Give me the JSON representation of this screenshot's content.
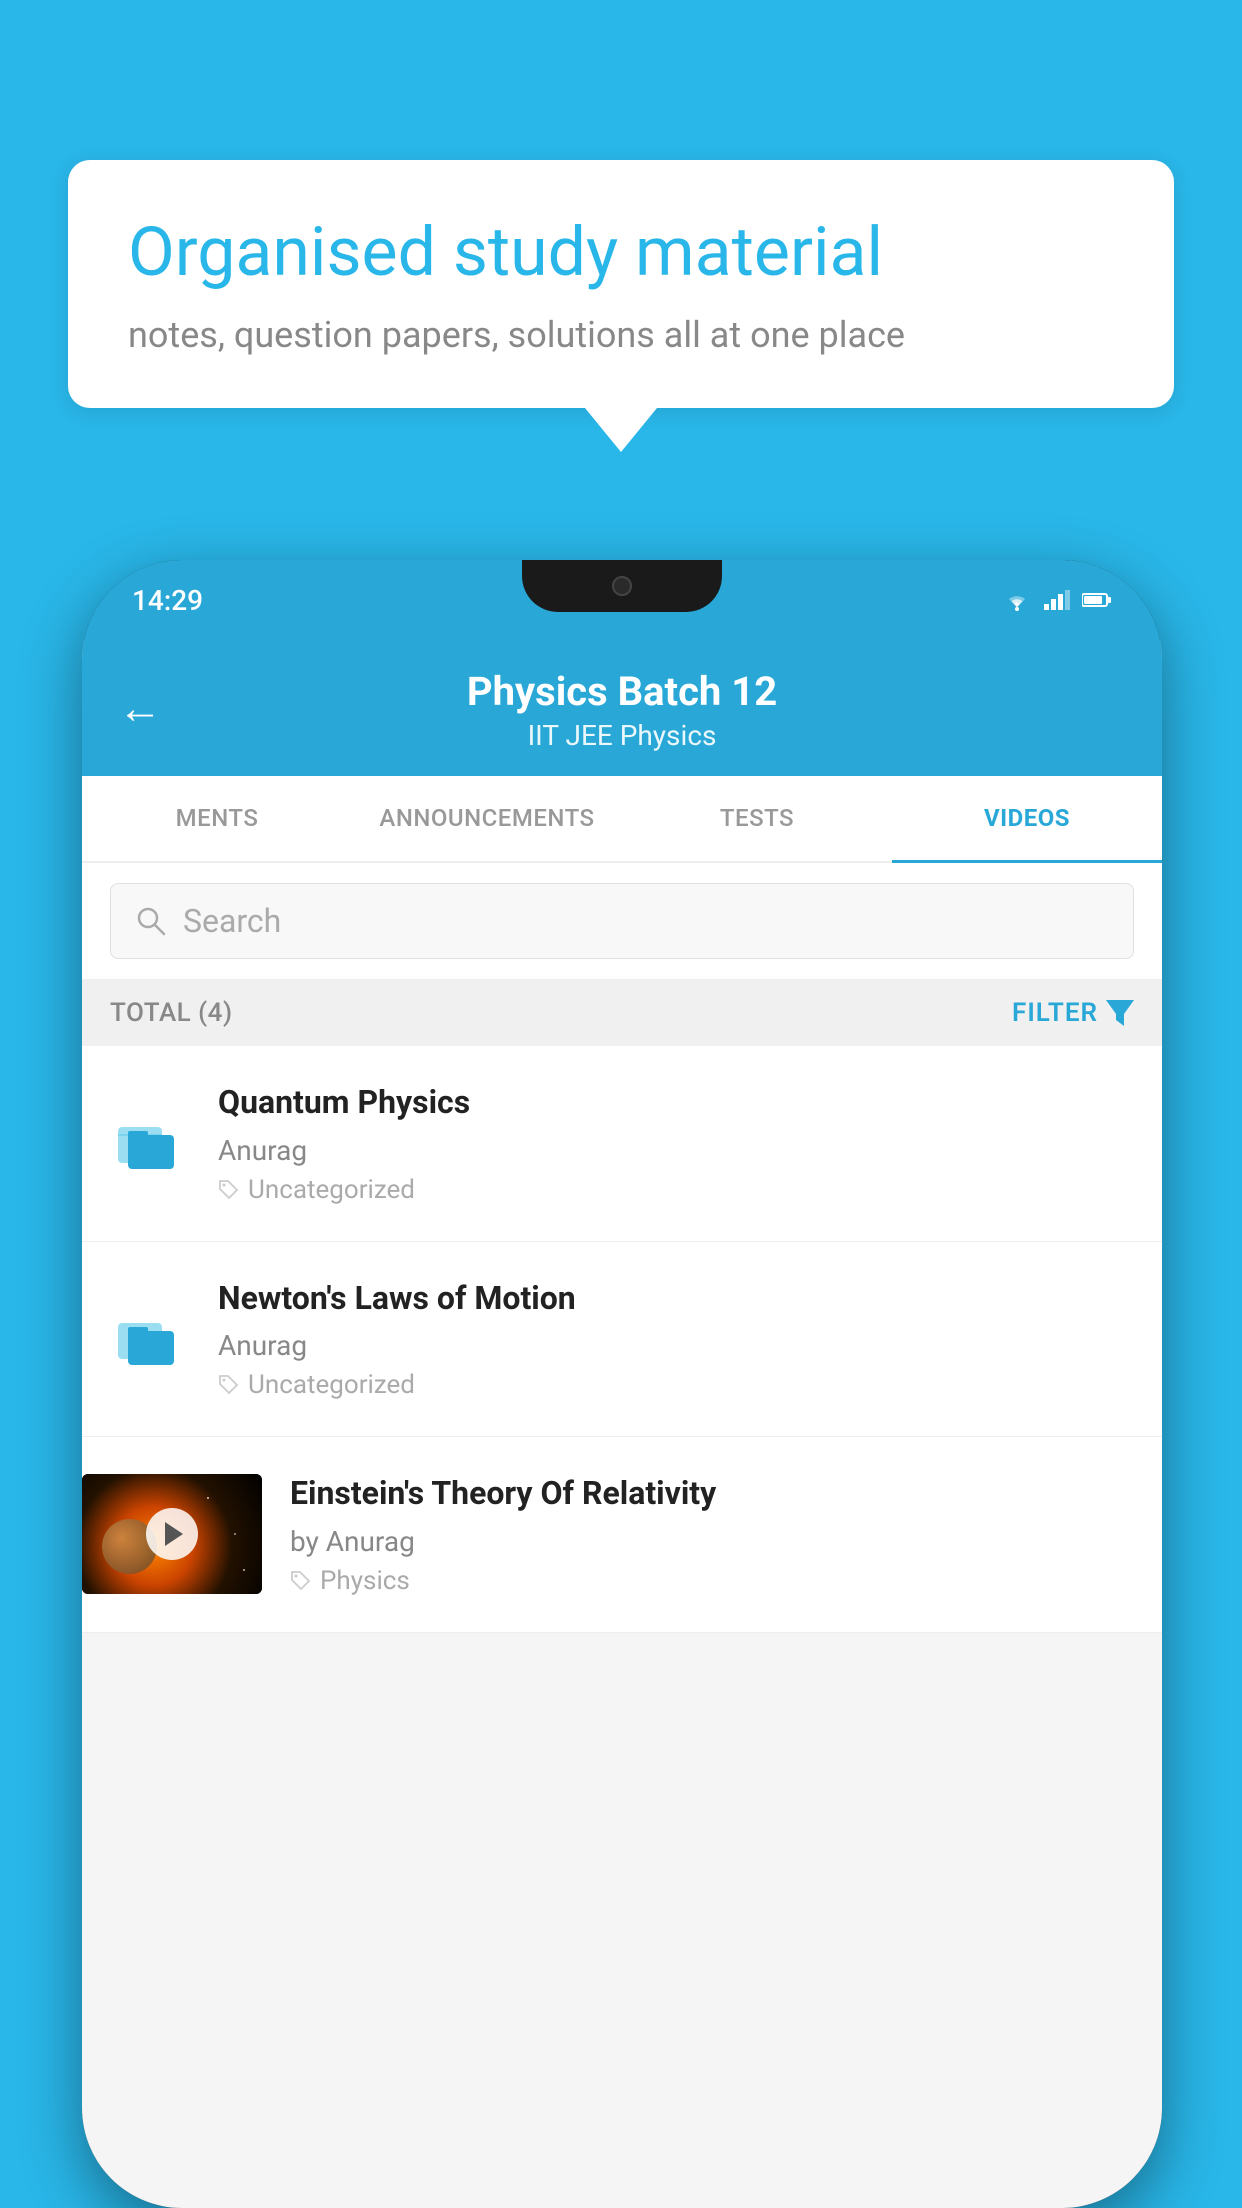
{
  "background": {
    "color": "#29b6e8"
  },
  "speech_bubble": {
    "title": "Organised study material",
    "subtitle": "notes, question papers, solutions all at one place"
  },
  "phone": {
    "status_bar": {
      "time": "14:29",
      "wifi": "▼",
      "signal": "▲",
      "battery": "▮"
    },
    "header": {
      "back_label": "←",
      "title": "Physics Batch 12",
      "subtitle": "IIT JEE   Physics"
    },
    "tabs": [
      {
        "label": "MENTS",
        "active": false
      },
      {
        "label": "ANNOUNCEMENTS",
        "active": false
      },
      {
        "label": "TESTS",
        "active": false
      },
      {
        "label": "VIDEOS",
        "active": true
      }
    ],
    "search": {
      "placeholder": "Search"
    },
    "filter_row": {
      "total_label": "TOTAL (4)",
      "filter_label": "FILTER"
    },
    "videos": [
      {
        "id": "quantum-physics",
        "title": "Quantum Physics",
        "author": "Anurag",
        "tag": "Uncategorized",
        "has_thumbnail": false
      },
      {
        "id": "newtons-laws",
        "title": "Newton's Laws of Motion",
        "author": "Anurag",
        "tag": "Uncategorized",
        "has_thumbnail": false
      },
      {
        "id": "einstein-relativity",
        "title": "Einstein's Theory Of Relativity",
        "author": "by Anurag",
        "tag": "Physics",
        "has_thumbnail": true
      }
    ]
  }
}
